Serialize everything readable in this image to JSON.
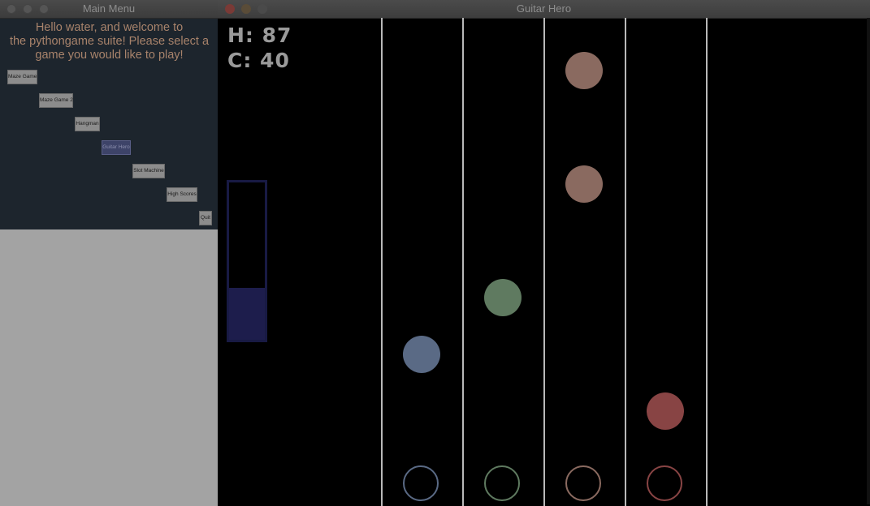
{
  "main_menu": {
    "title": "Main Menu",
    "welcome_lines": [
      "Hello water, and welcome to",
      "the pythongame suite! Please select a",
      "game you would like to play!"
    ],
    "buttons": [
      {
        "label": "Maze Game"
      },
      {
        "label": "Maze Game 2"
      },
      {
        "label": "Hangman"
      },
      {
        "label": "Guitar Hero",
        "active": true
      },
      {
        "label": "Slot Machine"
      },
      {
        "label": "High Scores"
      },
      {
        "label": "Quit"
      }
    ]
  },
  "game": {
    "title": "Guitar Hero",
    "hud": {
      "health": "H: 87",
      "combo": "C: 40"
    },
    "meter_level_percent": 33,
    "lanes": [
      {
        "color": "#5a6a85"
      },
      {
        "color": "#5f7a60"
      },
      {
        "color": "#8a6a60"
      },
      {
        "color": "#884444"
      }
    ]
  }
}
